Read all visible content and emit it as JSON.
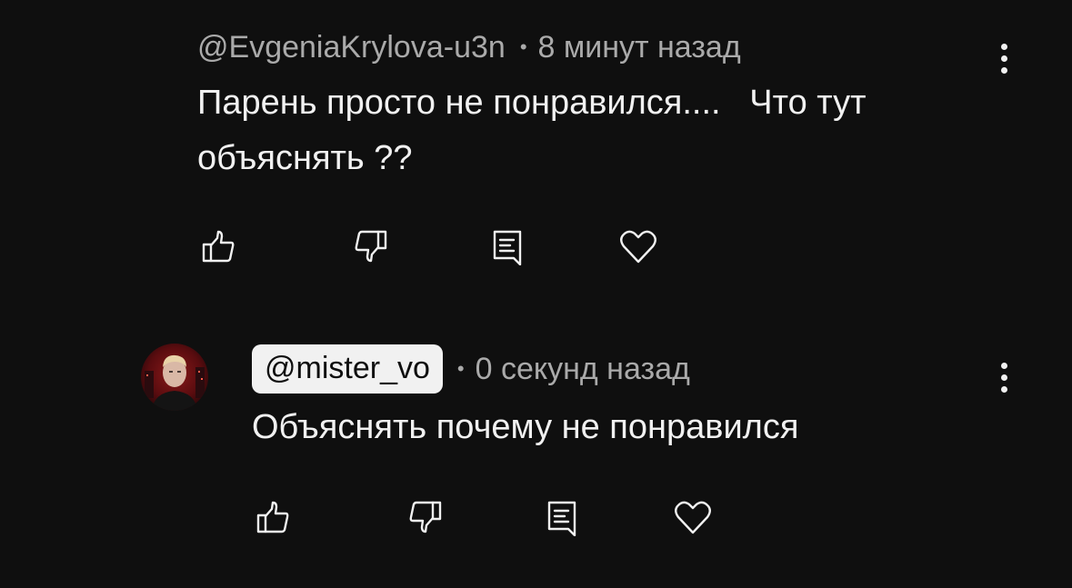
{
  "comments": [
    {
      "author": "@EvgeniaKrylova-u3n",
      "separator": "•",
      "time": "8 минут назад",
      "text": "Парень просто не понравился....   Что тут объяснять ??",
      "actions": [
        "like-icon",
        "dislike-icon",
        "reply-icon",
        "heart-icon"
      ]
    },
    {
      "author": "@mister_vo",
      "separator": "•",
      "time": "0 секунд назад",
      "text": "Объяснять почему не понравился",
      "actions": [
        "like-icon",
        "dislike-icon",
        "reply-icon",
        "heart-icon"
      ]
    }
  ],
  "colors": {
    "background": "#0f0f0f",
    "text": "#f1f1f1",
    "secondary": "#aaaaaa",
    "chip_background": "#f1f1f1"
  }
}
